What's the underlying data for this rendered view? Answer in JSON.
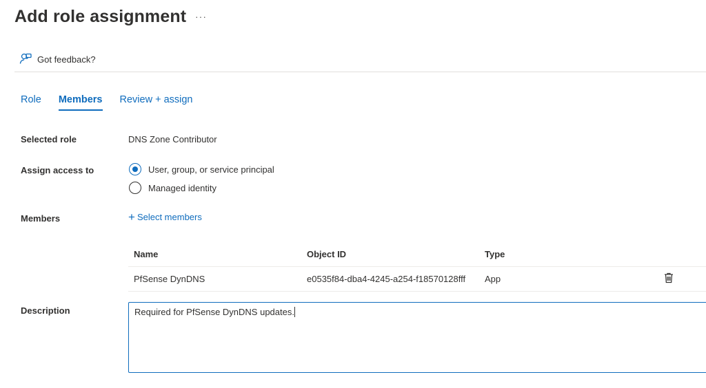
{
  "header": {
    "title": "Add role assignment",
    "more_label": "···"
  },
  "feedback": {
    "label": "Got feedback?",
    "icon": "feedback-person-icon"
  },
  "tabs": [
    {
      "label": "Role",
      "active": false
    },
    {
      "label": "Members",
      "active": true
    },
    {
      "label": "Review + assign",
      "active": false
    }
  ],
  "form": {
    "selected_role_label": "Selected role",
    "selected_role_value": "DNS Zone Contributor",
    "assign_access_label": "Assign access to",
    "assign_options": [
      {
        "label": "User, group, or service principal",
        "checked": true
      },
      {
        "label": "Managed identity",
        "checked": false
      }
    ],
    "members_label": "Members",
    "select_members_label": "Select members",
    "description_label": "Description",
    "description_value": "Required for PfSense DynDNS updates."
  },
  "members_table": {
    "columns": [
      "Name",
      "Object ID",
      "Type"
    ],
    "rows": [
      {
        "name": "PfSense DynDNS",
        "object_id": "e0535f84-dba4-4245-a254-f18570128fff",
        "type": "App",
        "delete_icon": "trash-icon"
      }
    ]
  },
  "colors": {
    "accent": "#0f6cbd",
    "text": "#323130",
    "divider": "#e1dfdd"
  }
}
